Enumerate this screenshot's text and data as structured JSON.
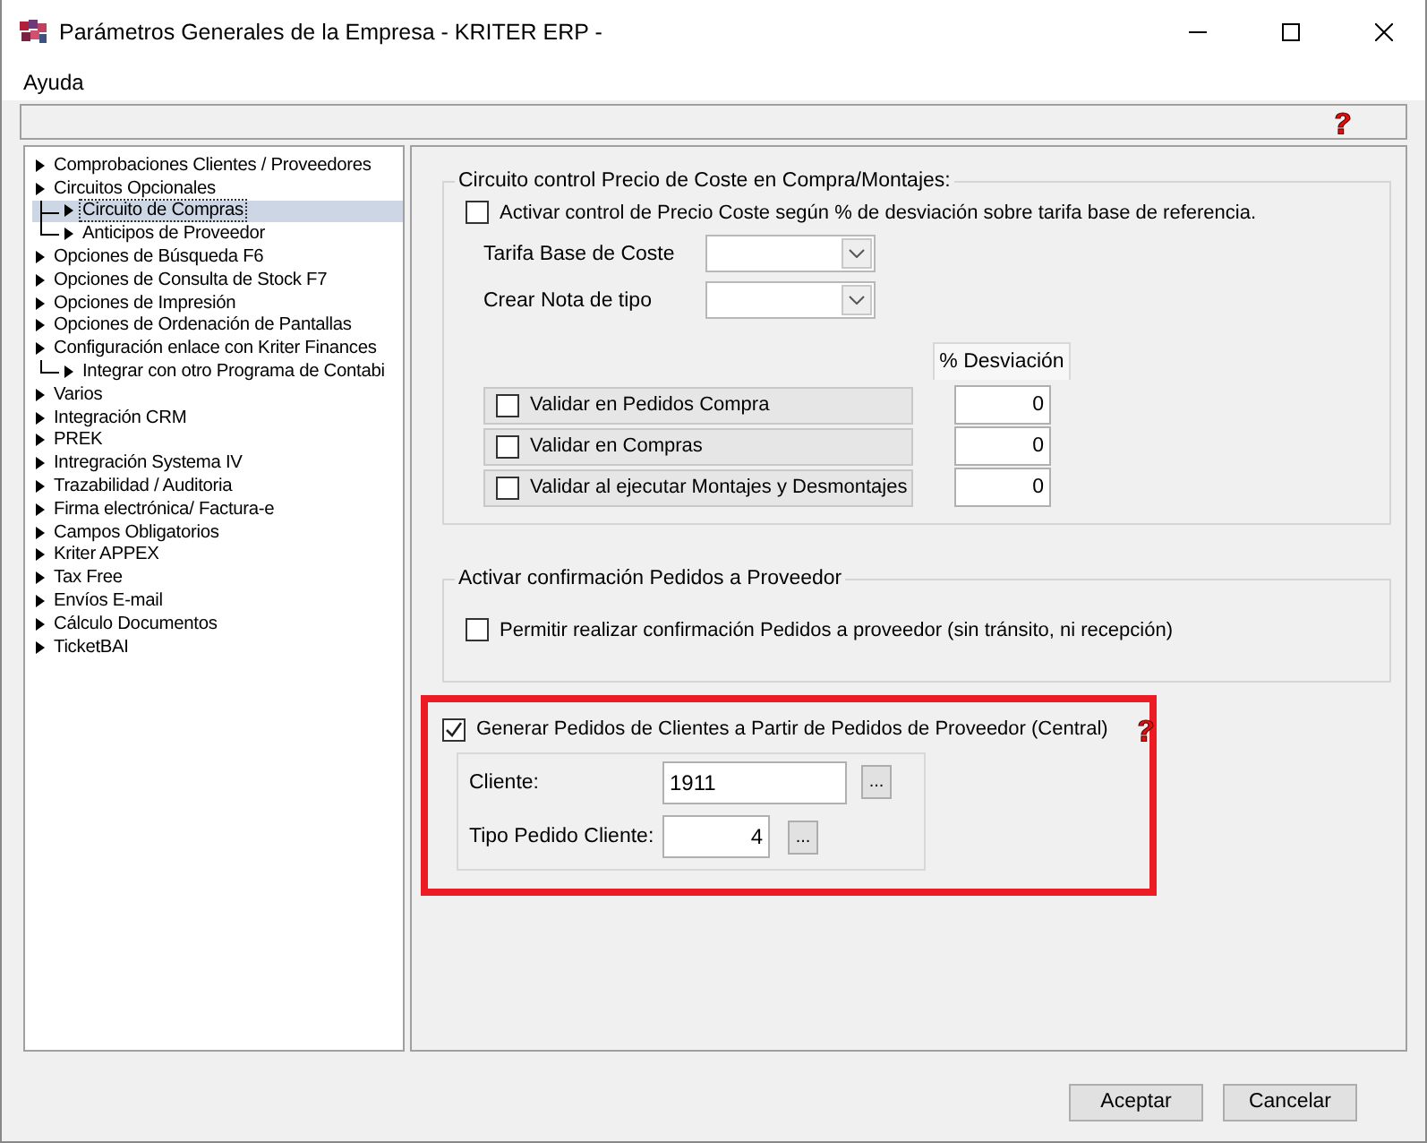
{
  "window": {
    "title": "Parámetros Generales de la Empresa - KRITER ERP -"
  },
  "menu": [
    "Ayuda"
  ],
  "tree": [
    {
      "label": "Comprobaciones Clientes / Proveedores",
      "selected": false
    },
    {
      "label": "Circuitos Opcionales",
      "selected": false,
      "children": [
        {
          "label": "Circuito de Compras",
          "selected": true
        },
        {
          "label": "Anticipos de Proveedor",
          "selected": false
        }
      ]
    },
    {
      "label": "Opciones de Búsqueda F6",
      "selected": false
    },
    {
      "label": "Opciones de Consulta de Stock F7",
      "selected": false
    },
    {
      "label": "Opciones de Impresión",
      "selected": false
    },
    {
      "label": "Opciones de Ordenación de Pantallas",
      "selected": false
    },
    {
      "label": "Configuración enlace con Kriter Finances",
      "selected": false,
      "children": [
        {
          "label": "Integrar con otro Programa de Contabi",
          "selected": false
        }
      ]
    },
    {
      "label": "Varios",
      "selected": false
    },
    {
      "label": "Integración CRM",
      "selected": false
    },
    {
      "label": "PREK",
      "selected": false
    },
    {
      "label": "Intregración Systema IV",
      "selected": false
    },
    {
      "label": "Trazabilidad / Auditoria",
      "selected": false
    },
    {
      "label": "Firma electrónica/ Factura-e",
      "selected": false
    },
    {
      "label": "Campos Obligatorios",
      "selected": false
    },
    {
      "label": "Kriter APPEX",
      "selected": false
    },
    {
      "label": "Tax Free",
      "selected": false
    },
    {
      "label": "Envíos E-mail",
      "selected": false
    },
    {
      "label": "Cálculo Documentos",
      "selected": false
    },
    {
      "label": "TicketBAI",
      "selected": false
    }
  ],
  "cost_control": {
    "legend": "Circuito control Precio de Coste en Compra/Montajes:",
    "activate": {
      "label": "Activar control de Precio Coste según % de desviación sobre tarifa base de referencia.",
      "checked": false
    },
    "combos": [
      {
        "label": "Tarifa Base de Coste"
      },
      {
        "label": "Crear Nota de tipo"
      }
    ],
    "deviation_header": "% Desviación",
    "validations": [
      {
        "label": "Validar en Pedidos Compra",
        "checked": false,
        "deviation": "0"
      },
      {
        "label": "Validar en Compras",
        "checked": false,
        "deviation": "0"
      },
      {
        "label": "Validar al ejecutar Montajes y Desmontajes",
        "checked": false,
        "deviation": "0"
      }
    ]
  },
  "confirmation": {
    "legend": "Activar confirmación Pedidos a Proveedor",
    "option": {
      "label": "Permitir realizar confirmación Pedidos a proveedor (sin tránsito, ni recepción)",
      "checked": false
    }
  },
  "central": {
    "highlighted": true,
    "option": {
      "label": "Generar Pedidos de Clientes a Partir de Pedidos de Proveedor (Central)",
      "checked": true
    },
    "fields": [
      {
        "label": "Cliente:",
        "value": "1911",
        "kind": "text"
      },
      {
        "label": "Tipo Pedido Cliente:",
        "value": "4",
        "kind": "number"
      }
    ],
    "browse": "..."
  },
  "buttons": [
    "Aceptar",
    "Cancelar"
  ]
}
